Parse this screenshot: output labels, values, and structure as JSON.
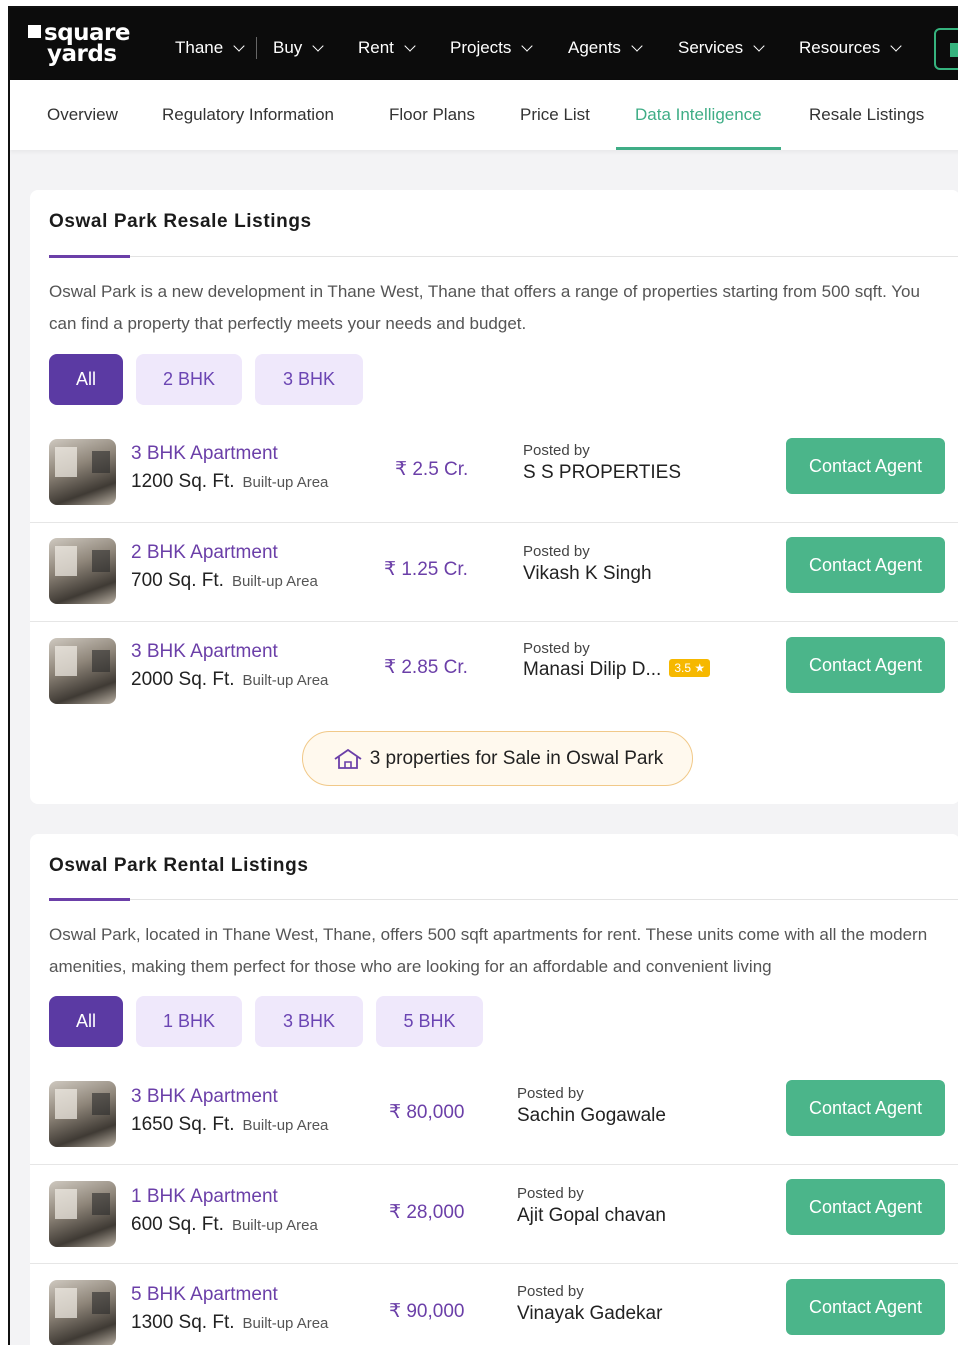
{
  "logo": {
    "line1": "square",
    "line2": "yards"
  },
  "topnav": [
    "Thane",
    "Buy",
    "Rent",
    "Projects",
    "Agents",
    "Services",
    "Resources"
  ],
  "subnav": [
    "Overview",
    "Regulatory Information",
    "Floor Plans",
    "Price List",
    "Data Intelligence",
    "Resale Listings"
  ],
  "resale": {
    "title": "Oswal Park Resale Listings",
    "description": "Oswal Park is a new development in Thane West, Thane that offers a range of properties starting from 500 sqft. You can find a property that perfectly meets your needs and budget.",
    "filters": [
      "All",
      "2 BHK",
      "3 BHK"
    ],
    "listings": [
      {
        "title": "3 BHK Apartment",
        "area": "1200 Sq. Ft.",
        "area_type": "Built-up Area",
        "price": "₹ 2.5 Cr.",
        "posted_by_label": "Posted by",
        "poster": "S S PROPERTIES",
        "rating": "",
        "cta": "Contact Agent"
      },
      {
        "title": "2 BHK Apartment",
        "area": "700 Sq. Ft.",
        "area_type": "Built-up Area",
        "price": "₹ 1.25 Cr.",
        "posted_by_label": "Posted by",
        "poster": "Vikash K Singh",
        "rating": "",
        "cta": "Contact Agent"
      },
      {
        "title": "3 BHK Apartment",
        "area": "2000 Sq. Ft.",
        "area_type": "Built-up Area",
        "price": "₹ 2.85 Cr.",
        "posted_by_label": "Posted by",
        "poster": "Manasi Dilip D...",
        "rating": "3.5 ★",
        "cta": "Contact Agent"
      }
    ],
    "summary": "3 properties for Sale in Oswal Park"
  },
  "rental": {
    "title": "Oswal Park Rental Listings",
    "description": "Oswal Park, located in Thane West, Thane, offers 500 sqft apartments for rent. These units come with all the modern amenities, making them perfect for those who are looking for an affordable and convenient living",
    "filters": [
      "All",
      "1 BHK",
      "3 BHK",
      "5 BHK"
    ],
    "listings": [
      {
        "title": "3 BHK Apartment",
        "area": "1650 Sq. Ft.",
        "area_type": "Built-up Area",
        "price": "₹ 80,000",
        "posted_by_label": "Posted by",
        "poster": "Sachin Gogawale",
        "cta": "Contact Agent"
      },
      {
        "title": "1 BHK Apartment",
        "area": "600 Sq. Ft.",
        "area_type": "Built-up Area",
        "price": "₹ 28,000",
        "posted_by_label": "Posted by",
        "poster": "Ajit Gopal chavan",
        "cta": "Contact Agent"
      },
      {
        "title": "5 BHK Apartment",
        "area": "1300 Sq. Ft.",
        "area_type": "Built-up Area",
        "price": "₹ 90,000",
        "posted_by_label": "Posted by",
        "poster": "Vinayak Gadekar",
        "cta": "Contact Agent"
      }
    ]
  },
  "colors": {
    "brand_purple": "#6b3fa8",
    "accent_green": "#4bb58a",
    "nav_bg": "#0c0c0c"
  }
}
